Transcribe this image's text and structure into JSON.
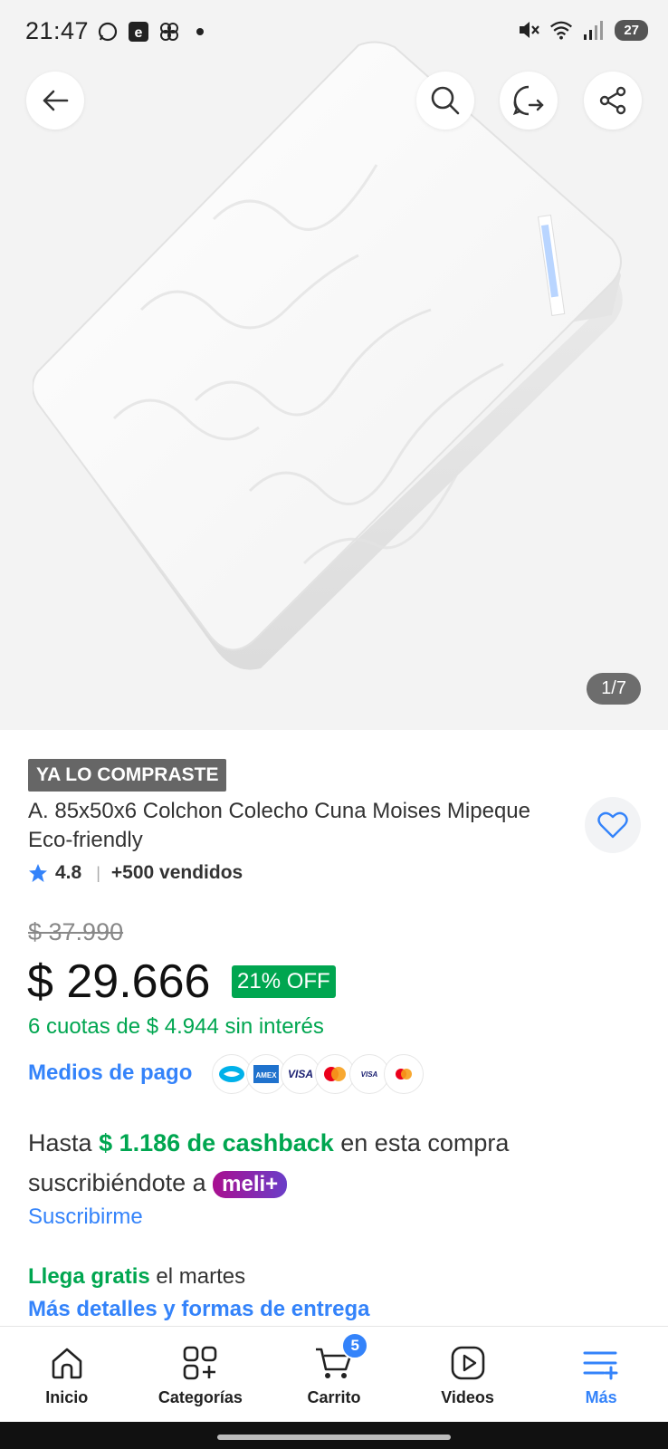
{
  "status_bar": {
    "time": "21:47",
    "left_icons": [
      "whatsapp-icon",
      "e-app-icon",
      "fan-app-icon",
      "dot-icon"
    ],
    "right_icons": [
      "mute-icon",
      "wifi-icon",
      "signal-icon"
    ],
    "battery": "27"
  },
  "hero": {
    "image_counter": "1/7",
    "buttons": [
      "back-icon",
      "search-icon",
      "whatsapp-share-icon",
      "share-icon"
    ]
  },
  "product": {
    "tag": "YA LO COMPRASTE",
    "title": "A. 85x50x6 Colchon Colecho Cuna Moises Mipeque Eco-friendly",
    "rating": "4.8",
    "sold": "+500 vendidos",
    "old_price": "$ 37.990",
    "price": "$ 29.666",
    "discount": "21% OFF",
    "installments": "6 cuotas de $ 4.944 sin interés",
    "payment_link": "Medios de pago",
    "payment_methods": [
      "Mercado Pago",
      "AMEX",
      "VISA",
      "Mastercard",
      "Visa Débito",
      "Maestro"
    ]
  },
  "cashback": {
    "prefix": "Hasta",
    "amount": "$ 1.186 de cashback",
    "suffix": "en esta compra suscribiéndote a",
    "badge": "meli+",
    "link": "Suscribirme"
  },
  "delivery": {
    "free": "Llega gratis",
    "when": "el martes",
    "link": "Más detalles y formas de entrega"
  },
  "bottom_nav": {
    "items": [
      {
        "label": "Inicio",
        "icon": "home-icon"
      },
      {
        "label": "Categorías",
        "icon": "categories-icon"
      },
      {
        "label": "Carrito",
        "icon": "cart-icon"
      },
      {
        "label": "Videos",
        "icon": "play-icon"
      },
      {
        "label": "Más",
        "icon": "menu-plus-icon"
      }
    ],
    "cart_count": "5",
    "active": "Más"
  },
  "colors": {
    "accent_blue": "#3483fa",
    "green": "#00a650"
  }
}
